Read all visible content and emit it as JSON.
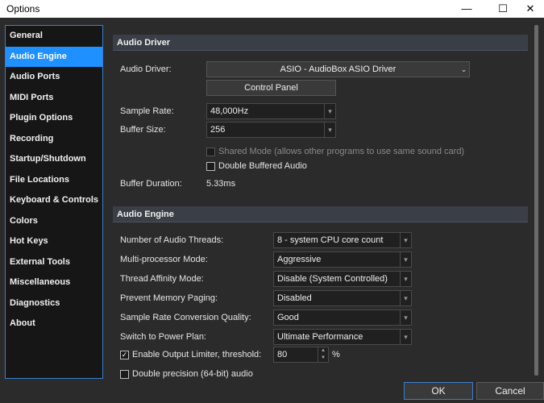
{
  "window": {
    "title": "Options",
    "minimize": "—",
    "maximize": "☐",
    "close": "✕"
  },
  "sidebar": {
    "items": [
      {
        "label": "General"
      },
      {
        "label": "Audio Engine"
      },
      {
        "label": "Audio Ports"
      },
      {
        "label": "MIDI Ports"
      },
      {
        "label": "Plugin Options"
      },
      {
        "label": "Recording"
      },
      {
        "label": "Startup/Shutdown"
      },
      {
        "label": "File Locations"
      },
      {
        "label": "Keyboard & Controls"
      },
      {
        "label": "Colors"
      },
      {
        "label": "Hot Keys"
      },
      {
        "label": "External Tools"
      },
      {
        "label": "Miscellaneous"
      },
      {
        "label": "Diagnostics"
      },
      {
        "label": "About"
      }
    ],
    "selected": "Audio Engine"
  },
  "audio_driver": {
    "header": "Audio Driver",
    "driver_label": "Audio Driver:",
    "driver_value": "ASIO - AudioBox ASIO Driver",
    "control_panel": "Control Panel",
    "sample_rate_label": "Sample Rate:",
    "sample_rate_value": "48,000Hz",
    "buffer_size_label": "Buffer Size:",
    "buffer_size_value": "256",
    "shared_mode": "Shared Mode (allows other programs to use same sound card)",
    "double_buffered": "Double Buffered Audio",
    "buffer_duration_label": "Buffer Duration:",
    "buffer_duration_value": "5.33ms"
  },
  "audio_engine": {
    "header": "Audio Engine",
    "threads_label": "Number of Audio Threads:",
    "threads_value": "8 - system CPU core count",
    "multiproc_label": "Multi-processor Mode:",
    "multiproc_value": "Aggressive",
    "affinity_label": "Thread Affinity Mode:",
    "affinity_value": "Disable (System Controlled)",
    "paging_label": "Prevent Memory Paging:",
    "paging_value": "Disabled",
    "src_label": "Sample Rate Conversion Quality:",
    "src_value": "Good",
    "power_label": "Switch to Power Plan:",
    "power_value": "Ultimate Performance",
    "limiter_label": "Enable Output Limiter, threshold:",
    "limiter_checked": "✓",
    "limiter_value": "80",
    "limiter_unit": "%",
    "double_precision": "Double precision (64-bit) audio"
  },
  "footer": {
    "ok": "OK",
    "cancel": "Cancel"
  },
  "icons": {
    "dropdown": "▾",
    "spin_up": "▲",
    "spin_down": "▼",
    "wide_dropdown": "⌄"
  }
}
